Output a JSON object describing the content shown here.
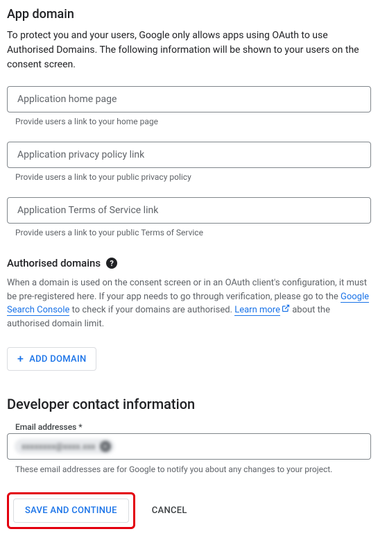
{
  "appDomain": {
    "title": "App domain",
    "description": "To protect you and your users, Google only allows apps using OAuth to use Authorised Domains. The following information will be shown to your users on the consent screen.",
    "fields": {
      "homePage": {
        "placeholder": "Application home page",
        "helper": "Provide users a link to your home page"
      },
      "privacy": {
        "placeholder": "Application privacy policy link",
        "helper": "Provide users a link to your public privacy policy"
      },
      "tos": {
        "placeholder": "Application Terms of Service link",
        "helper": "Provide users a link to your public Terms of Service"
      }
    }
  },
  "authorisedDomains": {
    "title": "Authorised domains",
    "descPart1": "When a domain is used on the consent screen or in an OAuth client's configuration, it must be pre-registered here. If your app needs to go through verification, please go to the ",
    "linkSearchConsole": "Google Search Console",
    "descPart2": " to check if your domains are authorised. ",
    "linkLearnMore": "Learn more",
    "descPart3": " about the authorised domain limit.",
    "addDomainLabel": "ADD DOMAIN"
  },
  "developerContact": {
    "title": "Developer contact information",
    "emailLabel": "Email addresses *",
    "chipText": "xxxxxxxx@xxxx.xxx",
    "helper": "These email addresses are for Google to notify you about any changes to your project."
  },
  "buttons": {
    "save": "SAVE AND CONTINUE",
    "cancel": "CANCEL"
  }
}
